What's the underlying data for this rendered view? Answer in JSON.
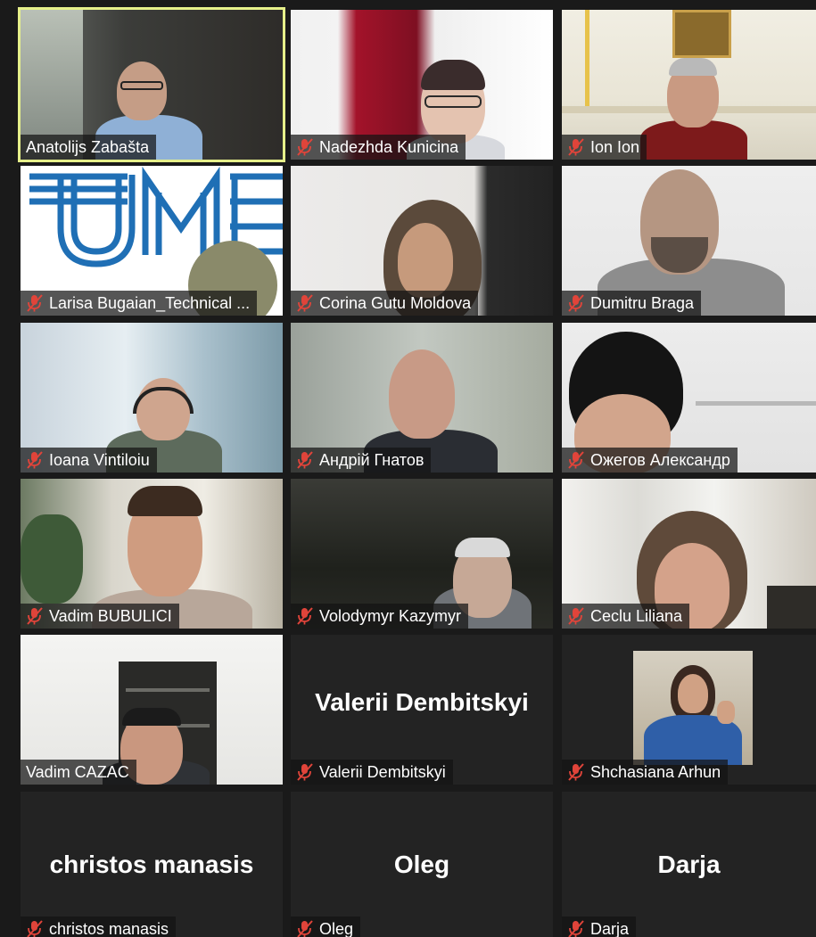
{
  "participants": [
    {
      "name": "Anatolijs Zabašta",
      "muted": false,
      "video": true,
      "active": true
    },
    {
      "name": "Nadezhda Kunicina",
      "muted": true,
      "video": true
    },
    {
      "name": "Ion Ion",
      "muted": true,
      "video": true
    },
    {
      "name": "Larisa Bugaian_Technical ...",
      "muted": true,
      "video": true
    },
    {
      "name": "Corina Gutu Moldova",
      "muted": true,
      "video": true
    },
    {
      "name": "Dumitru Braga",
      "muted": true,
      "video": true
    },
    {
      "name": "Ioana Vintiloiu",
      "muted": true,
      "video": true
    },
    {
      "name": "Андрій Гнатов",
      "muted": true,
      "video": true
    },
    {
      "name": "Ожегов Александр",
      "muted": true,
      "video": true
    },
    {
      "name": "Vadim BUBULICI",
      "muted": true,
      "video": true
    },
    {
      "name": "Volodymyr Kazymyr",
      "muted": true,
      "video": true
    },
    {
      "name": "Ceclu Liliana",
      "muted": true,
      "video": true
    },
    {
      "name": "Vadim CAZAC",
      "muted": false,
      "video": true
    },
    {
      "name": "Valerii Dembitskyi",
      "display_name": "Valerii Dembitskyi",
      "muted": true,
      "video": false
    },
    {
      "name": "Shchasiana Arhun",
      "muted": true,
      "video": false,
      "profile_picture": true
    },
    {
      "name": "christos manasis",
      "display_name": "christos manasis",
      "muted": true,
      "video": false
    },
    {
      "name": "Oleg",
      "display_name": "Oleg",
      "muted": true,
      "video": false
    },
    {
      "name": "Darja",
      "display_name": "Darja",
      "muted": true,
      "video": false
    }
  ],
  "colors": {
    "active_speaker_border": "#e6f08a",
    "muted_icon": "#e0443a",
    "background": "#1a1a1a",
    "tile_background": "#232323"
  },
  "icons": {
    "muted": "microphone-muted-icon"
  },
  "logo_text": "UM"
}
